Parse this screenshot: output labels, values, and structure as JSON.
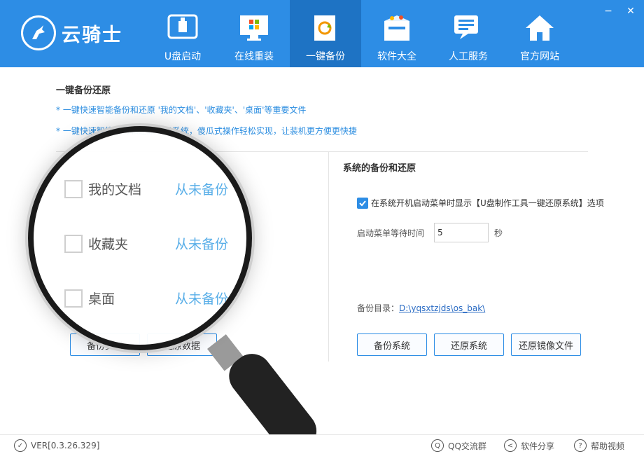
{
  "app": {
    "logo_text": "云骑士"
  },
  "window": {
    "minimize": "−",
    "close": "✕"
  },
  "nav": [
    {
      "label": "U盘启动",
      "icon": "usb-icon",
      "active": false
    },
    {
      "label": "在线重装",
      "icon": "windows-monitor-icon",
      "active": false
    },
    {
      "label": "一键备份",
      "icon": "backup-refresh-icon",
      "active": true
    },
    {
      "label": "软件大全",
      "icon": "software-box-icon",
      "active": false
    },
    {
      "label": "人工服务",
      "icon": "chat-service-icon",
      "active": false
    },
    {
      "label": "官方网站",
      "icon": "home-icon",
      "active": false
    }
  ],
  "section": {
    "title": "一键备份还原",
    "desc1": "* 一键快速智能备份和还原 '我的文档'、'收藏夹'、'桌面'等重要文件",
    "desc2": "* 一键快速智能备份和还原本机系统，傻瓜式操作轻松实现，让装机更方便更快捷"
  },
  "left_items": [
    {
      "label": "我的文档",
      "status": "从未备份"
    },
    {
      "label": "收藏夹",
      "status": "从未备份"
    },
    {
      "label": "桌面",
      "status": "从未备份"
    }
  ],
  "left_buttons": {
    "backup": "备份资料",
    "restore": "还原数据"
  },
  "right": {
    "title": "系统的备份和还原",
    "option_label": "在系统开机启动菜单时显示【U盘制作工具一键还原系统】选项",
    "wait_label": "启动菜单等待时间",
    "wait_value": "5",
    "wait_unit": "秒",
    "backup_dir_label": "备份目录：",
    "backup_dir_path": "D:\\yqsxtzjds\\os_bak\\",
    "buttons": {
      "backup": "备份系统",
      "restore": "还原系统",
      "restore_image": "还原镜像文件"
    }
  },
  "footer": {
    "version": "VER[0.3.26.329]",
    "qq": "QQ交流群",
    "share": "软件分享",
    "help": "帮助视频"
  },
  "colors": {
    "header_bg": "#2d8de5",
    "active_tab": "#1e73c4",
    "accent": "#2b8de0"
  }
}
